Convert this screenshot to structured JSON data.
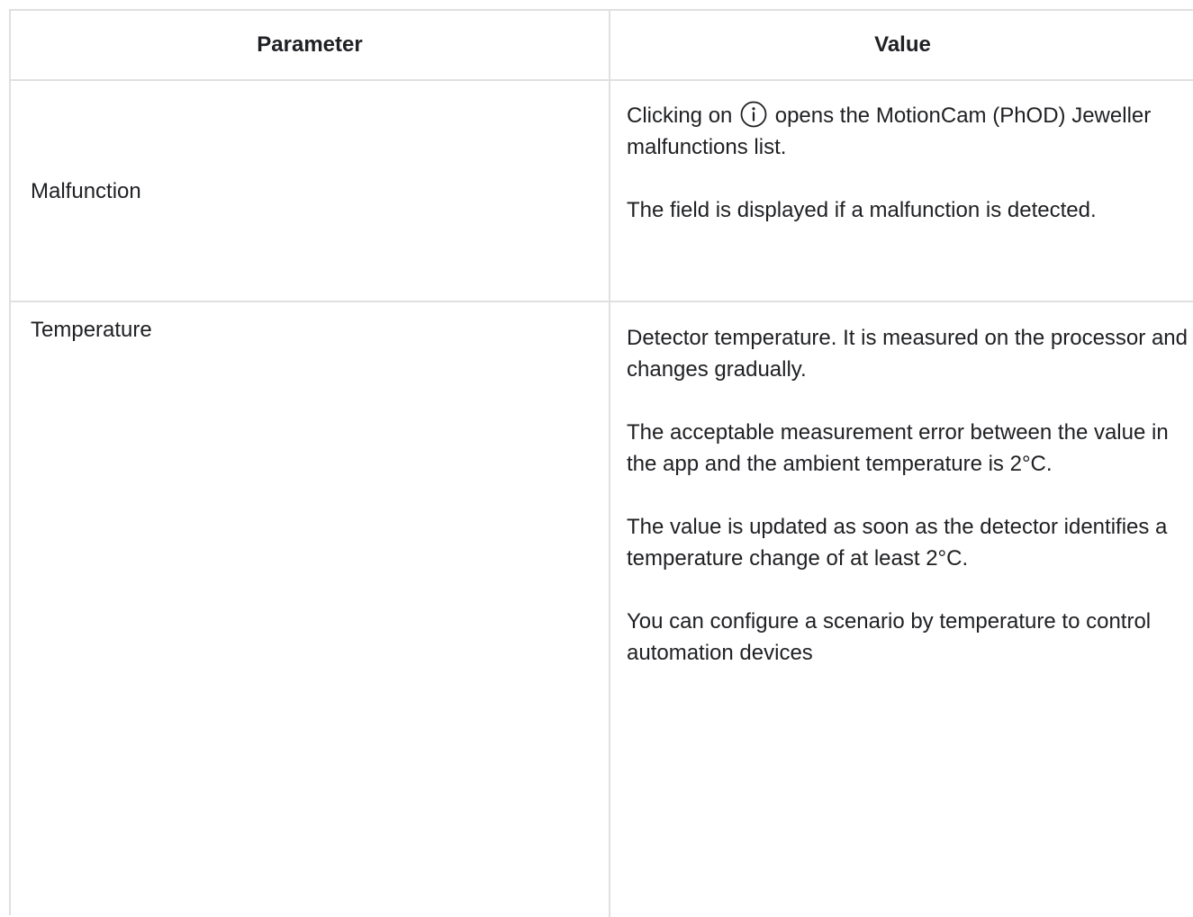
{
  "table": {
    "headers": {
      "parameter": "Parameter",
      "value": "Value"
    },
    "rows": [
      {
        "parameter": "Malfunction",
        "value_prefix": "Clicking on",
        "icon": "info-circle-icon",
        "value_suffix": "opens the MotionCam (PhOD) Jeweller malfunctions list.",
        "paragraphs": [
          "The field is displayed if a malfunction is detected."
        ]
      },
      {
        "parameter": "Temperature",
        "paragraphs": [
          "Detector temperature. It is measured on the processor and changes gradually.",
          "The acceptable measurement error between the value in the app and the ambient temperature is 2°C.",
          "The value is updated as soon as the detector identifies a temperature change of at least 2°C.",
          "You can configure a scenario by temperature to control automation devices"
        ]
      }
    ]
  },
  "colors": {
    "border": "#e0e0e0",
    "text": "#202124"
  }
}
